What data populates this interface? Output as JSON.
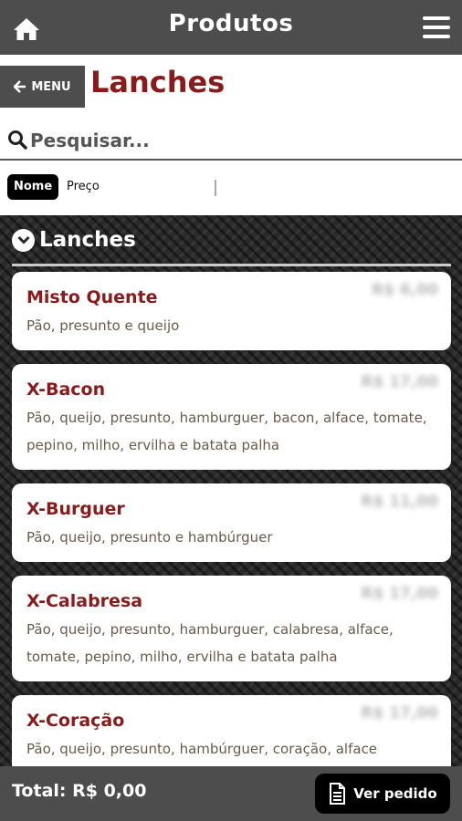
{
  "header": {
    "title": "Produtos",
    "home_icon": "home-icon",
    "menu_icon": "hamburger-menu-icon"
  },
  "nav": {
    "back_label": "MENU",
    "section_title": "Lanches"
  },
  "search": {
    "placeholder": "Pesquisar..."
  },
  "sort": {
    "active": "Nome",
    "other": "Preço"
  },
  "group": {
    "title": "Lanches"
  },
  "products": [
    {
      "name": "Misto Quente",
      "description": "Pão, presunto e queijo",
      "price": "R$ 6,00"
    },
    {
      "name": "X-Bacon",
      "description": "Pão, queijo, presunto, hamburguer, bacon, alface, tomate, pepino, milho, ervilha e batata palha",
      "price": "R$ 17,00"
    },
    {
      "name": "X-Burguer",
      "description": "Pão, queijo, presunto e hambúrguer",
      "price": "R$ 11,00"
    },
    {
      "name": "X-Calabresa",
      "description": "Pão, queijo, presunto, hamburguer, calabresa, alface, tomate, pepino, milho, ervilha e batata palha",
      "price": "R$ 17,00"
    },
    {
      "name": "X-Coração",
      "description": "Pão, queijo, presunto, hambúrguer, coração, alface",
      "price": "R$ 17,00"
    }
  ],
  "footer": {
    "total": "Total: R$ 0,00",
    "order_button": "Ver pedido"
  },
  "colors": {
    "bar": "#4d4d4d",
    "accent": "#8b1a1a",
    "description": "#6b5a4a"
  }
}
